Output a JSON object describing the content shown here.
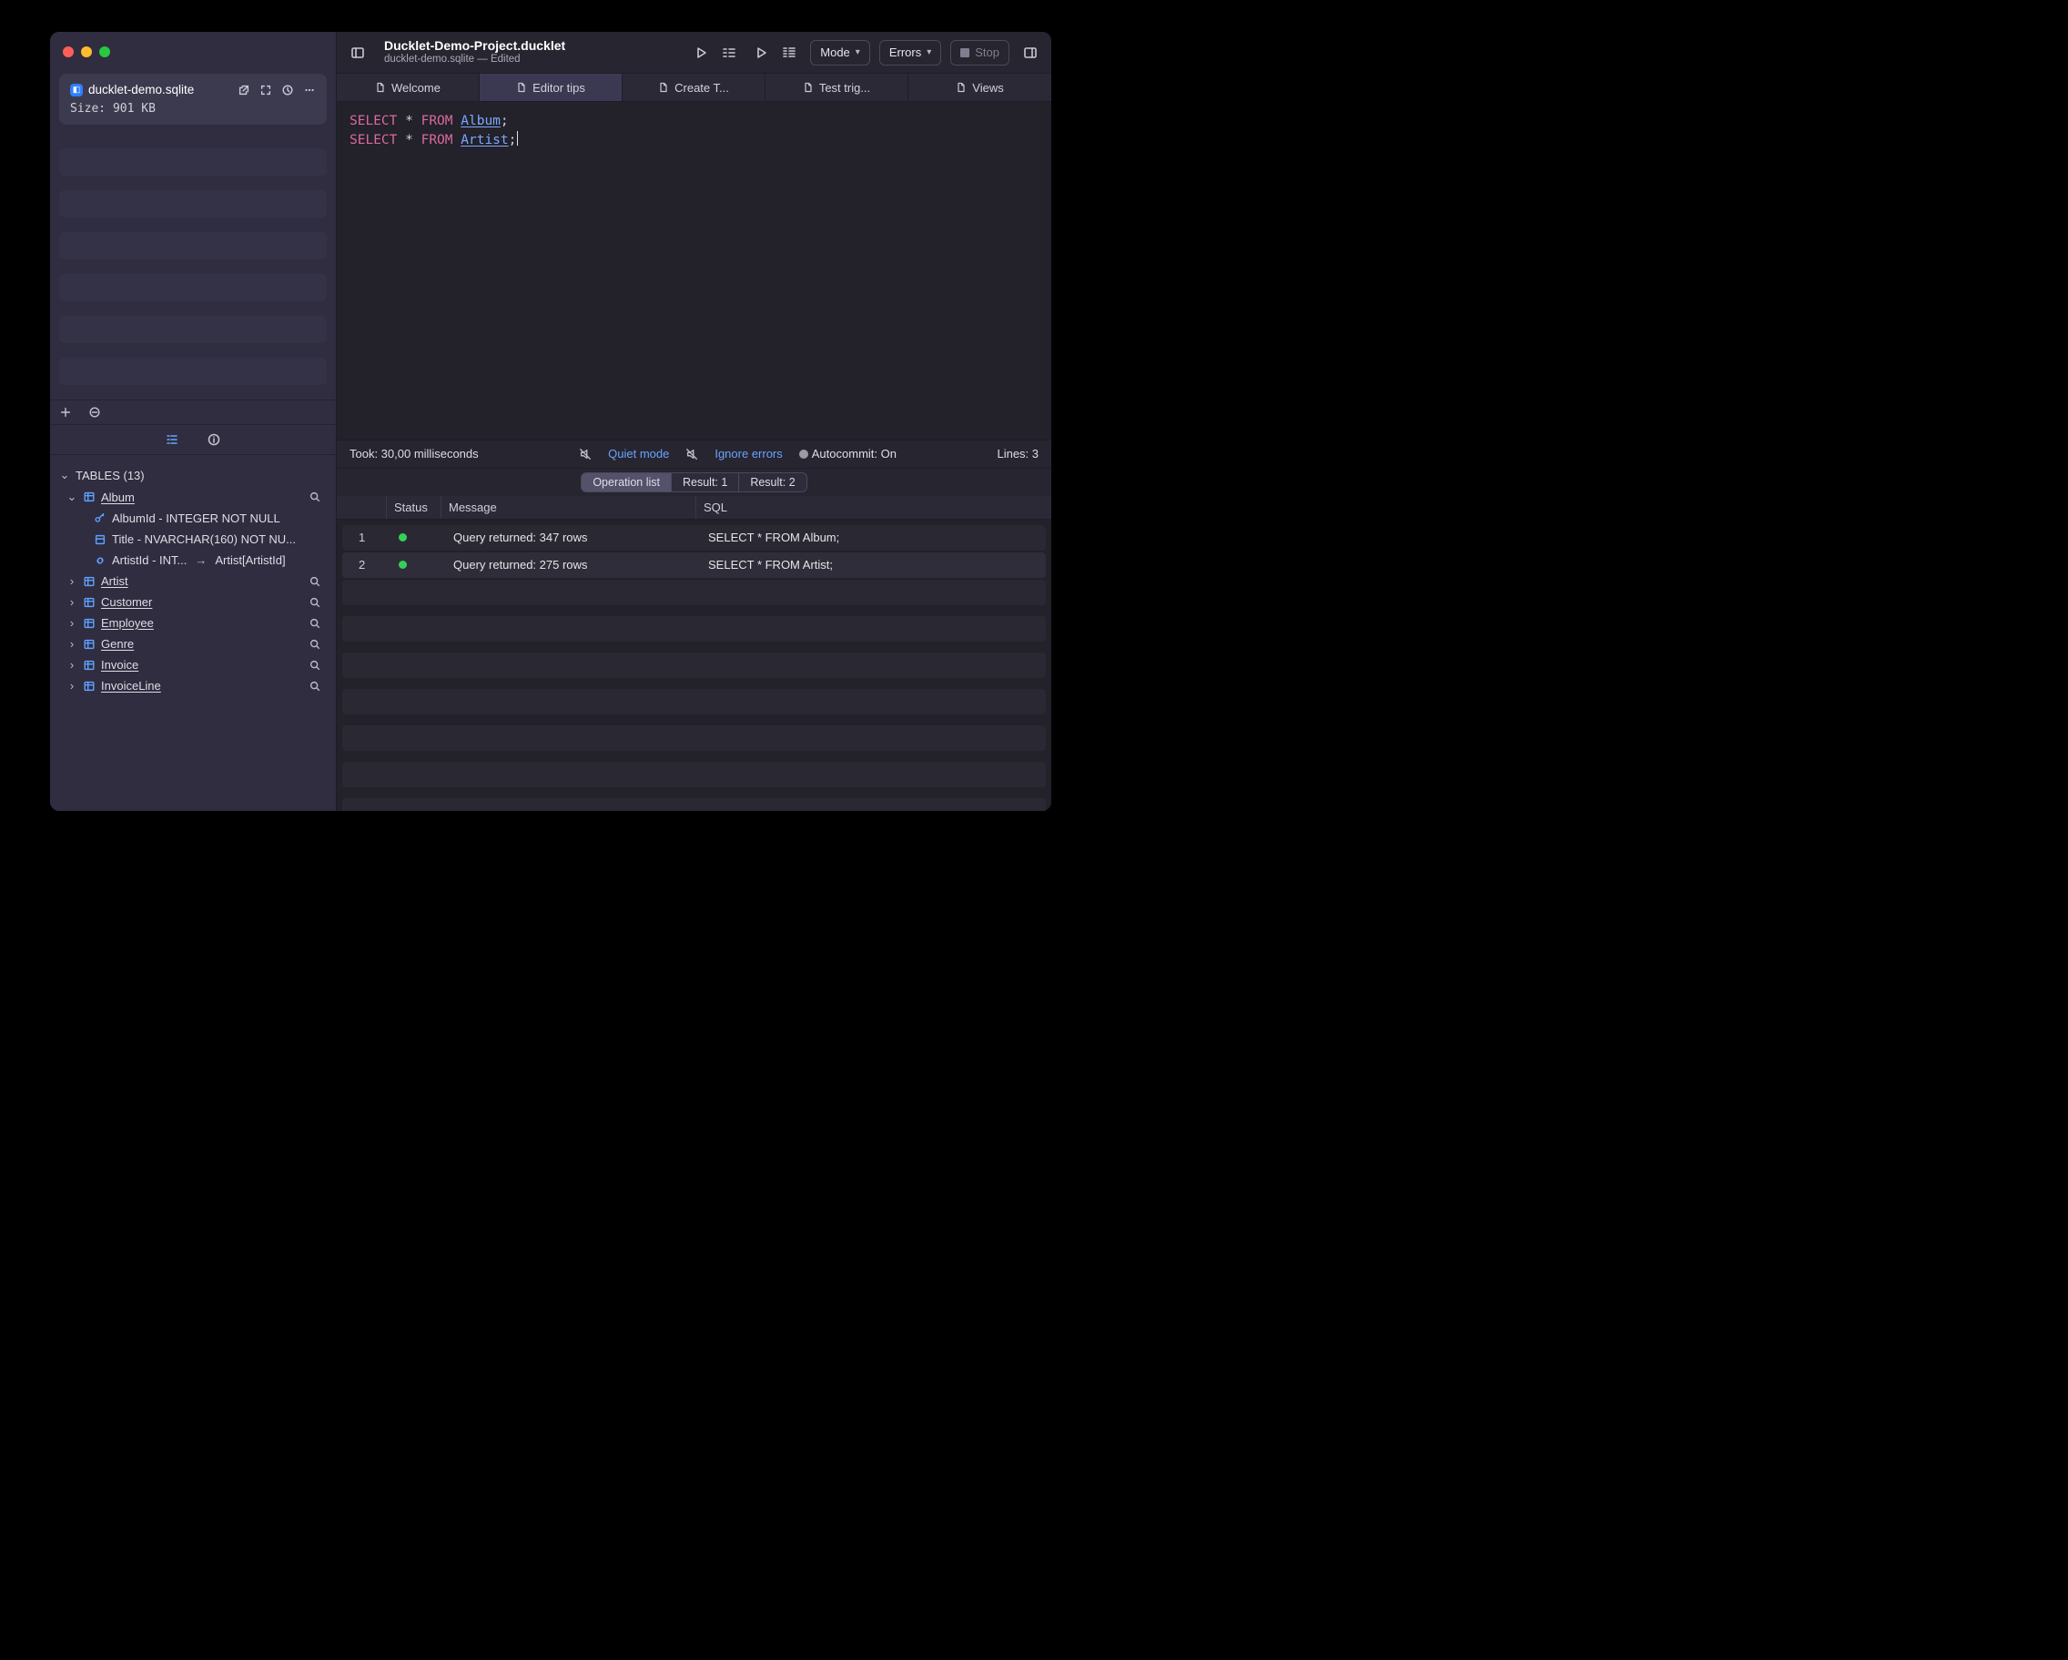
{
  "window": {
    "title": "Ducklet-Demo-Project.ducklet",
    "subtitle": "ducklet-demo.sqlite — Edited"
  },
  "toolbar": {
    "mode_label": "Mode",
    "errors_label": "Errors",
    "stop_label": "Stop"
  },
  "tabs": [
    {
      "label": "Welcome"
    },
    {
      "label": "Editor tips"
    },
    {
      "label": "Create T..."
    },
    {
      "label": "Test trig..."
    },
    {
      "label": "Views"
    }
  ],
  "editor": {
    "lines": [
      {
        "kw1": "SELECT",
        "star": "*",
        "kw2": "FROM",
        "ident": "Album",
        "semi": ";"
      },
      {
        "kw1": "SELECT",
        "star": "*",
        "kw2": "FROM",
        "ident": "Artist",
        "semi": ";"
      }
    ]
  },
  "statusbar": {
    "took": "Took: 30,00 milliseconds",
    "quiet": "Quiet mode",
    "ignore": "Ignore errors",
    "autocommit": "Autocommit: On",
    "lines": "Lines: 3"
  },
  "result_tabs": {
    "op": "Operation list",
    "r1": "Result: 1",
    "r2": "Result: 2"
  },
  "results": {
    "headers": {
      "status": "Status",
      "message": "Message",
      "sql": "SQL"
    },
    "rows": [
      {
        "n": "1",
        "message": "Query returned: 347 rows",
        "sql": "SELECT * FROM Album;"
      },
      {
        "n": "2",
        "message": "Query returned: 275 rows",
        "sql": "SELECT * FROM Artist;"
      }
    ]
  },
  "sidebar": {
    "db": {
      "name": "ducklet-demo.sqlite",
      "size": "Size: 901 KB"
    },
    "tree_header": "TABLES (13)",
    "tables": [
      {
        "name": "Album",
        "open": true,
        "columns": [
          {
            "icon": "key",
            "text": "AlbumId - INTEGER NOT NULL"
          },
          {
            "icon": "col",
            "text": "Title - NVARCHAR(160) NOT NU..."
          },
          {
            "icon": "link",
            "text": "ArtistId - INT...",
            "ref": "Artist[ArtistId]"
          }
        ]
      },
      {
        "name": "Artist"
      },
      {
        "name": "Customer"
      },
      {
        "name": "Employee"
      },
      {
        "name": "Genre"
      },
      {
        "name": "Invoice"
      },
      {
        "name": "InvoiceLine"
      }
    ]
  }
}
